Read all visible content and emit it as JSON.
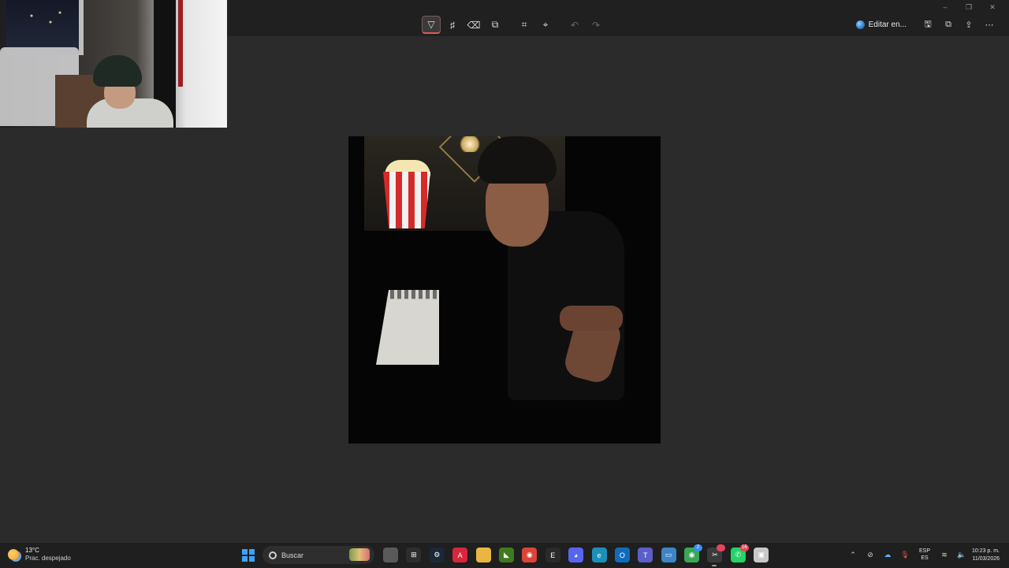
{
  "toolbar": {
    "tools": [
      {
        "name": "ballpoint-pen-icon",
        "glyph": "▽"
      },
      {
        "name": "highlighter-icon",
        "glyph": "♯"
      },
      {
        "name": "eraser-icon",
        "glyph": "⌫"
      },
      {
        "name": "shapes-icon",
        "glyph": "⧉"
      },
      {
        "name": "crop-icon",
        "glyph": "⌗"
      },
      {
        "name": "text-actions-icon",
        "glyph": "⌖"
      },
      {
        "name": "undo-icon",
        "glyph": "↶"
      },
      {
        "name": "redo-icon",
        "glyph": "↷"
      }
    ],
    "edit_in_label": "Editar en...",
    "actions": [
      {
        "name": "save-icon",
        "glyph": "🖫"
      },
      {
        "name": "copy-icon",
        "glyph": "⧉"
      },
      {
        "name": "share-icon",
        "glyph": "⇪"
      },
      {
        "name": "more-icon",
        "glyph": "⋯"
      }
    ],
    "window_controls": [
      "–",
      "❐",
      "✕"
    ]
  },
  "taskbar": {
    "weather_temp": "13°C",
    "weather_desc": "Prac. despejado",
    "search_label": "Buscar",
    "apps": [
      {
        "name": "notepad-icon",
        "color": "#5a5a5a",
        "glyph": ""
      },
      {
        "name": "microsoft-store-icon",
        "color": "#2d2d2d",
        "glyph": "⊞"
      },
      {
        "name": "steam-icon",
        "color": "#1b2838",
        "glyph": "⚙"
      },
      {
        "name": "acrobat-icon",
        "color": "#d7263d",
        "glyph": "A"
      },
      {
        "name": "file-explorer-icon",
        "color": "#e9b640",
        "glyph": ""
      },
      {
        "name": "nvidia-icon",
        "color": "#3f7a1e",
        "glyph": "◣"
      },
      {
        "name": "chrome-icon",
        "color": "#db4437",
        "glyph": "◉"
      },
      {
        "name": "epic-games-icon",
        "color": "#2a2a2a",
        "glyph": "E"
      },
      {
        "name": "discord-icon",
        "color": "#5865f2",
        "glyph": "◕"
      },
      {
        "name": "edge-icon",
        "color": "#1e8fb8",
        "glyph": "e"
      },
      {
        "name": "outlook-icon",
        "color": "#0f6cbd",
        "glyph": "O"
      },
      {
        "name": "teams-icon",
        "color": "#5b5fc7",
        "glyph": "T"
      },
      {
        "name": "remote-desktop-icon",
        "color": "#3b86c6",
        "glyph": "▭"
      },
      {
        "name": "chrome-profile-icon",
        "color": "#3aa757",
        "glyph": "◉",
        "badge": "2",
        "badge_blue": true
      },
      {
        "name": "snipping-tool-icon",
        "color": "#3a3a3a",
        "glyph": "✂",
        "badge": "",
        "running": true
      },
      {
        "name": "whatsapp-icon",
        "color": "#25d366",
        "glyph": "✆",
        "badge": "16"
      },
      {
        "name": "screen-capture-icon",
        "color": "#c8c8c8",
        "glyph": "▣"
      }
    ],
    "lang_top": "ESP",
    "lang_bottom": "ES",
    "time": "10:23 p. m.",
    "date": "11/03/2026"
  }
}
